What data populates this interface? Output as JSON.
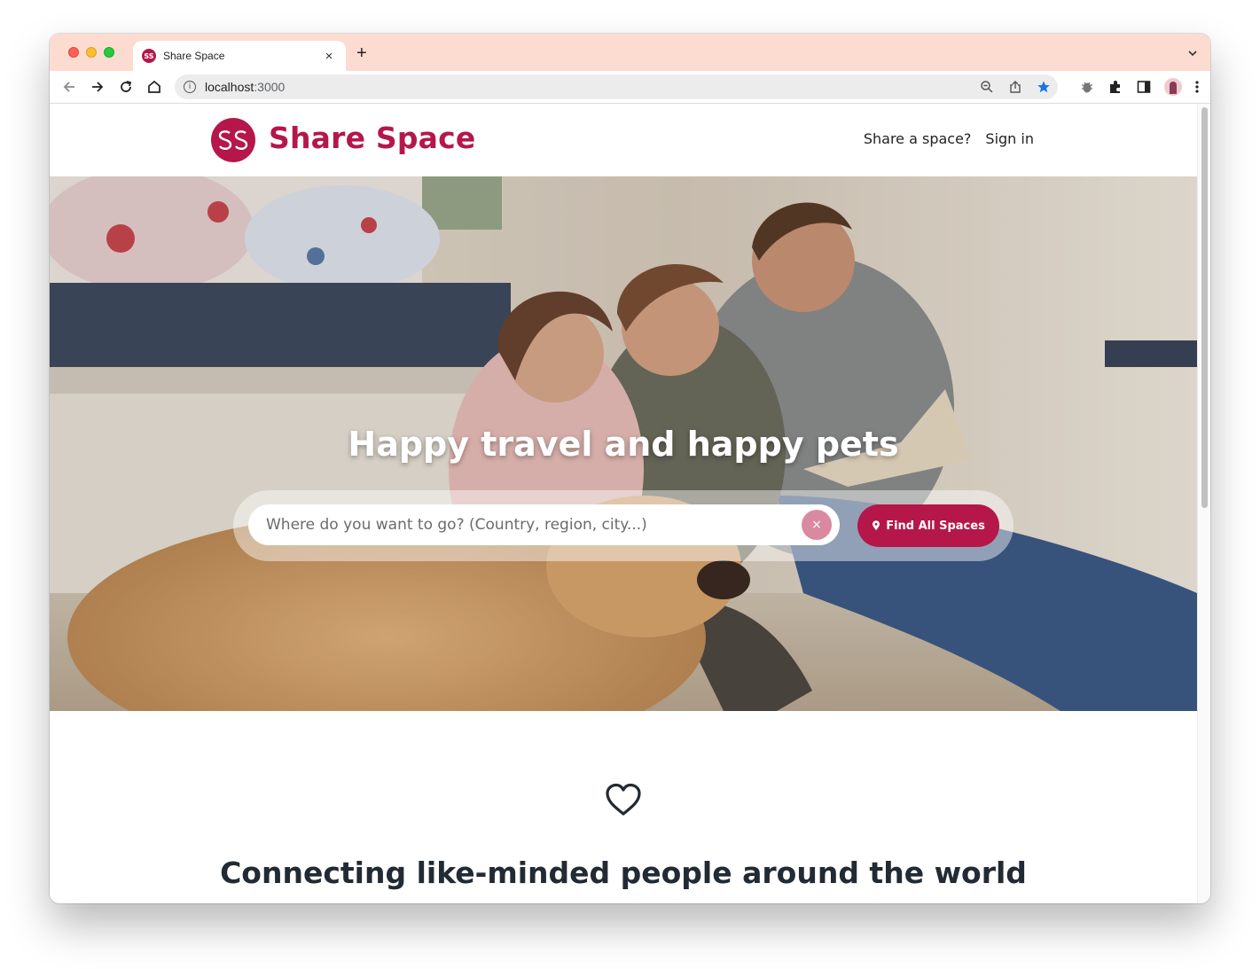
{
  "browser": {
    "tab_title": "Share Space",
    "favicon_text": "SS",
    "new_tab_symbol": "+",
    "close_symbol": "×",
    "url_host": "localhost",
    "url_port": ":3000",
    "bookmark_color": "#1a73e8"
  },
  "header": {
    "logo_text": "Share Space",
    "logo_mark": "SS",
    "nav_links": [
      "Share a space?",
      "Sign in"
    ],
    "brand_color": "#b5174a"
  },
  "hero": {
    "heading": "Happy travel and happy pets",
    "search_placeholder": "Where do you want to go? (Country, region, city...)",
    "clear_symbol": "×",
    "find_button_label": "Find All Spaces",
    "find_button_icon": "map-pin-icon"
  },
  "section": {
    "icon": "heart-icon",
    "heading": "Connecting like-minded people around the world"
  }
}
